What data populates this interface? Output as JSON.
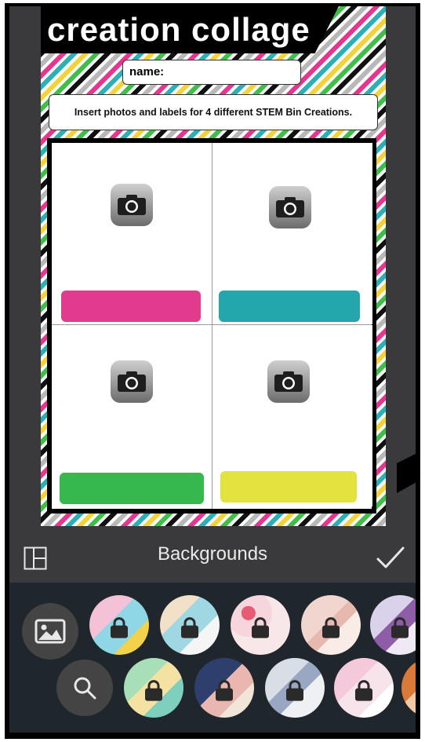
{
  "poster": {
    "title": "creation collage",
    "name_label": "name:",
    "instructions": "Insert photos and labels for 4 different STEM Bin Creations.",
    "credit": "",
    "cells": [
      {
        "icon": "camera-icon",
        "label_color": "#e13b8e"
      },
      {
        "icon": "camera-icon",
        "label_color": "#23a7ad"
      },
      {
        "icon": "camera-icon",
        "label_color": "#37b84d"
      },
      {
        "icon": "camera-icon",
        "label_color": "#e3e23f"
      }
    ]
  },
  "toolbar": {
    "title": "Backgrounds",
    "layout_icon": "layout-grid-icon",
    "confirm_icon": "checkmark-icon"
  },
  "tray": {
    "row1_tool": "image-icon",
    "row2_tool": "search-icon",
    "row1_backgrounds": [
      {
        "name": "pattern-1",
        "colors": [
          "#f3c2d7",
          "#8fd6e6",
          "#f2d24b"
        ],
        "locked": true
      },
      {
        "name": "pattern-2",
        "colors": [
          "#f2e0c9",
          "#9fd7e2",
          "#f5f5f5"
        ],
        "locked": true
      },
      {
        "name": "pattern-3",
        "colors": [
          "#f6d6dc",
          "#e55c73",
          "#f8e7e9"
        ],
        "locked": true
      },
      {
        "name": "pattern-4",
        "colors": [
          "#f1d6cf",
          "#e7b8ad",
          "#f9ece7"
        ],
        "locked": true
      },
      {
        "name": "pattern-5",
        "colors": [
          "#d9d2ea",
          "#8d5ea7",
          "#efe9f6"
        ],
        "locked": true
      }
    ],
    "row2_backgrounds": [
      {
        "name": "pattern-6",
        "colors": [
          "#a9dfb8",
          "#f3e2a1",
          "#7fcfbe"
        ],
        "locked": true
      },
      {
        "name": "pattern-7",
        "colors": [
          "#2e3f6e",
          "#e9b7b0",
          "#f1e5d8"
        ],
        "locked": true
      },
      {
        "name": "pattern-8",
        "colors": [
          "#d9dde6",
          "#9aa7c2",
          "#eef0f4"
        ],
        "locked": true
      },
      {
        "name": "pattern-9",
        "colors": [
          "#f4c9d9",
          "#f7e3ea",
          "#ffffff"
        ],
        "locked": true
      },
      {
        "name": "pattern-10",
        "colors": [
          "#d97a3a",
          "#f1c9a6",
          "#fff0e3"
        ],
        "locked": false
      }
    ]
  },
  "colors": {
    "screen_bg": "#3a3a3c",
    "tray_bg": "#1f262c",
    "accent_pink": "#e13b8e"
  }
}
